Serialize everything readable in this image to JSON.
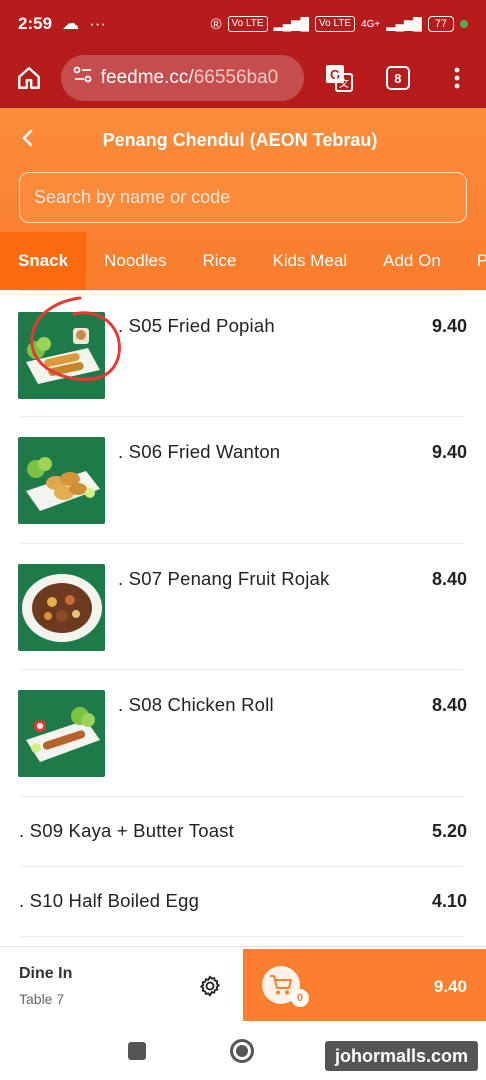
{
  "status_bar": {
    "time": "2:59",
    "battery": "77",
    "net1": "Vo LTE",
    "net2": "Vo LTE",
    "net3": "4G+"
  },
  "browser": {
    "url_main": "feedme.cc/",
    "url_rest": "66556ba0",
    "tab_count": "8"
  },
  "header": {
    "title": "Penang Chendul (AEON Tebrau)"
  },
  "search": {
    "placeholder": "Search by name or code"
  },
  "categories": [
    "Snack",
    "Noodles",
    "Rice",
    "Kids Meal",
    "Add On",
    "P"
  ],
  "items": [
    {
      "name": ". S05 Fried Popiah",
      "price": "9.40",
      "image": "fried-popiah"
    },
    {
      "name": ". S06 Fried Wanton",
      "price": "9.40",
      "image": "fried-wanton"
    },
    {
      "name": ". S07 Penang Fruit Rojak",
      "price": "8.40",
      "image": "fruit-rojak"
    },
    {
      "name": ". S08 Chicken Roll",
      "price": "8.40",
      "image": "chicken-roll"
    },
    {
      "name": ". S09 Kaya + Butter Toast",
      "price": "5.20"
    },
    {
      "name": ". S10 Half Boiled Egg",
      "price": "4.10"
    }
  ],
  "order": {
    "mode": "Dine In",
    "table": "Table 7",
    "cart_count": "0",
    "cart_total": "9.40"
  },
  "watermark": "johormalls.com",
  "colors": {
    "status_bar": "#b71c1c",
    "brand_orange": "#fb7f2f",
    "active_tab": "#fb6a0e",
    "annotation_red": "#e53935"
  }
}
